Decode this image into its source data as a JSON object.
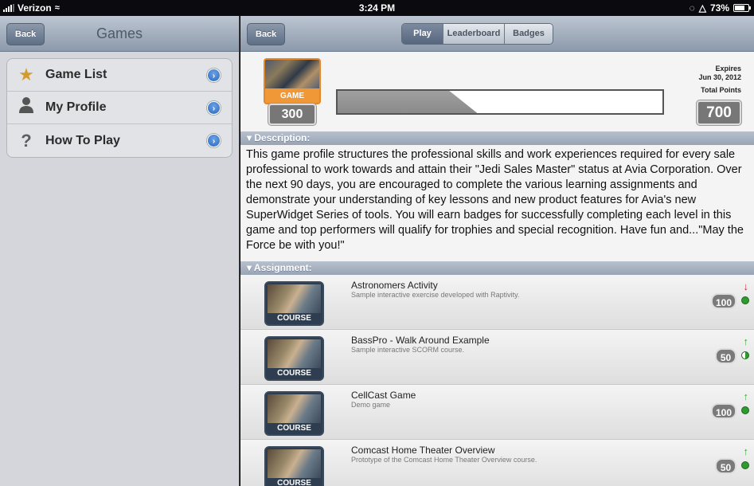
{
  "status_bar": {
    "carrier": "Verizon",
    "time": "3:24 PM",
    "battery": "73%"
  },
  "left": {
    "back_label": "Back",
    "title": "Games",
    "menu": [
      {
        "label": "Game List",
        "icon": "star-icon"
      },
      {
        "label": "My Profile",
        "icon": "person-icon"
      },
      {
        "label": "How To Play",
        "icon": "question-icon"
      }
    ]
  },
  "right": {
    "back_label": "Back",
    "tabs": [
      {
        "label": "Play",
        "active": true
      },
      {
        "label": "Leaderboard",
        "active": false
      },
      {
        "label": "Badges",
        "active": false
      }
    ],
    "game_tag": "GAME",
    "current_points": "300",
    "progress_fraction": 0.43,
    "expires_label": "Expires",
    "expires_date": "Jun 30, 2012",
    "total_points_label": "Total Points",
    "total_points": "700",
    "description_header": "Description:",
    "description": "This game profile structures the professional skills and work experiences required for every sale professional to work towards and attain their \"Jedi Sales Master\" status at Avia Corporation. Over the next 90 days, you are encouraged to complete the various learning assignments and demonstrate your understanding of key lessons and new product features for Avia's new SuperWidget Series of tools. You will earn badges for successfully completing each level in this game and top performers will qualify for trophies and special recognition. Have fun and...\"May the Force be with you!\"",
    "assignment_header": "Assignment:",
    "course_tag": "COURSE",
    "assignments": [
      {
        "title": "Astronomers Activity",
        "subtitle": "Sample interactive exercise developed with Raptivity.",
        "points": "100",
        "arrow": "down",
        "status": "complete"
      },
      {
        "title": "BassPro - Walk Around Example",
        "subtitle": "Sample interactive SCORM course.",
        "points": "50",
        "arrow": "up",
        "status": "in-progress"
      },
      {
        "title": "CellCast Game",
        "subtitle": "Demo game",
        "points": "100",
        "arrow": "up",
        "status": "complete"
      },
      {
        "title": "Comcast Home Theater Overview",
        "subtitle": "Prototype of the Comcast Home Theater Overview course.",
        "points": "50",
        "arrow": "up",
        "status": "complete"
      }
    ]
  },
  "colors": {
    "nav_gradient_top": "#bdc6d2",
    "nav_gradient_bottom": "#8c9aab",
    "game_orange": "#f09838",
    "status_green": "#2f9b2f",
    "arrow_red": "#d23",
    "arrow_green": "#3a3"
  }
}
